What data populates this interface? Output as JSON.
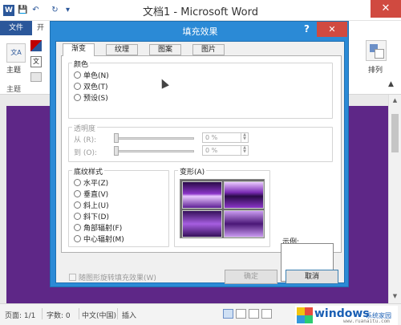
{
  "window": {
    "title": "文档1 - Microsoft Word",
    "app_icon": "W",
    "close_glyph": "✕",
    "qat": {
      "save_icon": "💾",
      "undo_icon": "↶",
      "redo_icon": "↻",
      "customize_icon": "▾"
    }
  },
  "ribbon": {
    "file_tab": "文件",
    "partial_tab": "开",
    "theme_button": "主题",
    "group_label": "主题",
    "theme_icon_text": "文A",
    "fonts_icon_text": "文",
    "arrange_button": "排列",
    "collapse_glyph": "▲"
  },
  "dialog": {
    "title": "填充效果",
    "help_glyph": "?",
    "close_glyph": "✕",
    "tabs": [
      "渐变",
      "纹理",
      "图案",
      "图片"
    ],
    "active_tab": "渐变",
    "colors_group": {
      "label": "颜色",
      "options": [
        "单色(N)",
        "双色(T)",
        "预设(S)"
      ]
    },
    "transparency_group": {
      "label": "透明度",
      "from_label": "从 (R):",
      "to_label": "到 (O):",
      "from_value": "0 %",
      "to_value": "0 %"
    },
    "shading_group": {
      "label": "底纹样式",
      "options": [
        "水平(Z)",
        "垂直(V)",
        "斜上(U)",
        "斜下(D)",
        "角部辐射(F)",
        "中心辐射(M)"
      ]
    },
    "variants_label": "变形(A)",
    "sample_label": "示例:",
    "rotate_checkbox": "随图形旋转填充效果(W)",
    "ok_button": "确定",
    "cancel_button": "取消"
  },
  "statusbar": {
    "page": "页面: 1/1",
    "words": "字数: 0",
    "language": "中文(中国)",
    "mode": "插入"
  },
  "watermark": {
    "brand": "windows",
    "suffix": "系统家园",
    "url": "www.ruanaitu.com"
  },
  "colors": {
    "word_blue": "#2b579a",
    "dialog_blue": "#2b8ad6",
    "close_red": "#d04a40",
    "page_purple": "#5e2787"
  }
}
